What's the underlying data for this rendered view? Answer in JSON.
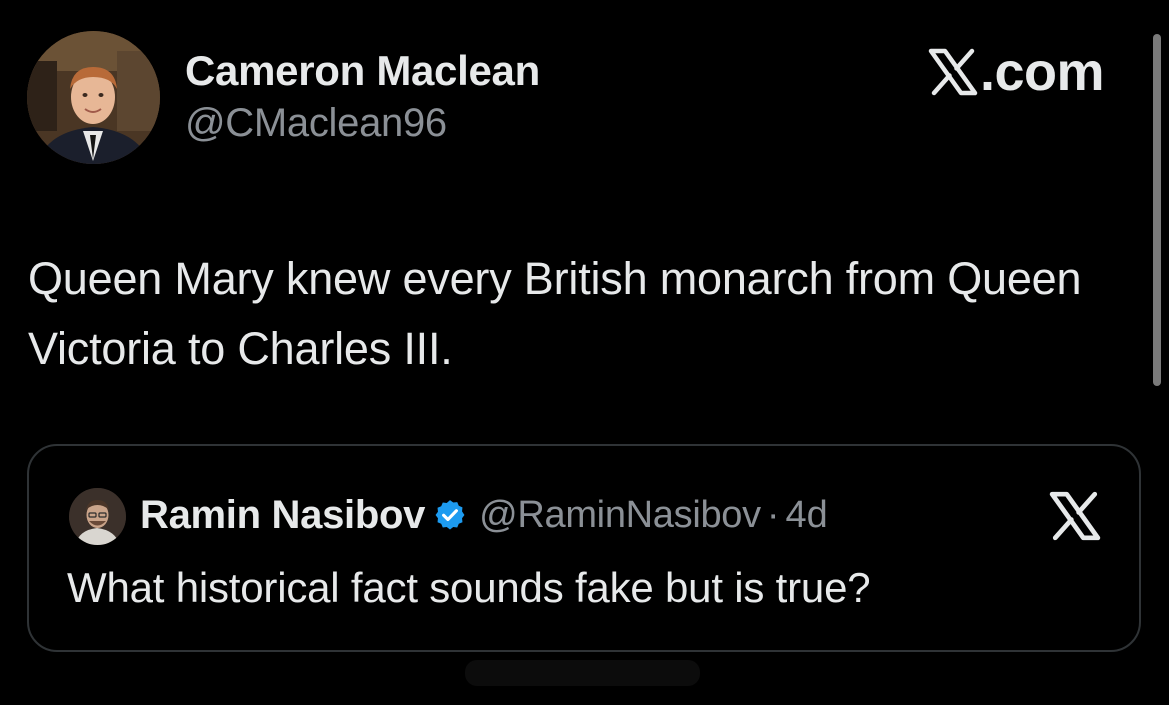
{
  "author": {
    "name": "Cameron Maclean",
    "handle": "@CMaclean96",
    "avatar_icon": "profile-photo"
  },
  "brand": {
    "label": ".com",
    "icon": "x-logo-icon"
  },
  "tweet": {
    "text": "Queen Mary knew every British monarch from Queen Victoria to Charles III."
  },
  "quoted_tweet": {
    "name": "Ramin Nasibov",
    "handle": "@RaminNasibov",
    "separator": "·",
    "time": "4d",
    "text": "What historical fact sounds fake but is true?",
    "verified": true,
    "verified_color": "#1d9bf0",
    "platform_icon": "x-logo-icon"
  },
  "colors": {
    "background": "#000000",
    "text_primary": "#e7e9ea",
    "text_secondary": "#8b9096",
    "border": "#2f3336"
  }
}
